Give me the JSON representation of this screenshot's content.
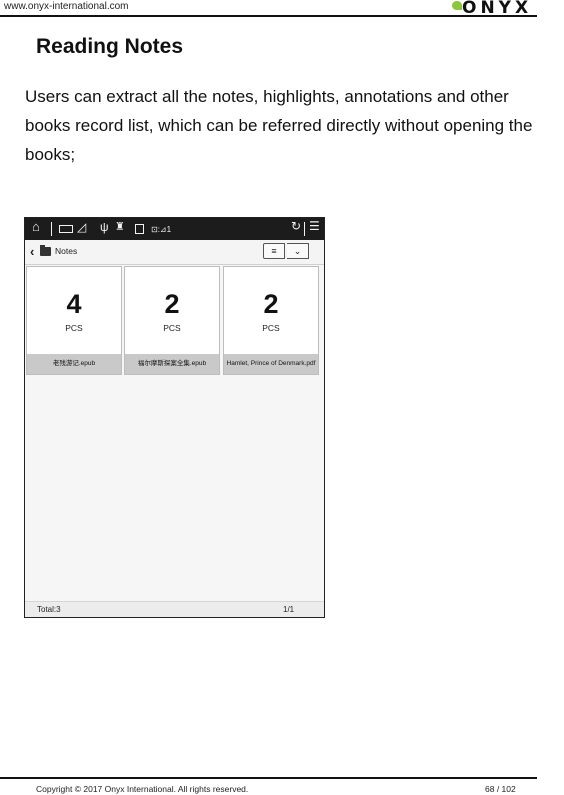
{
  "header": {
    "url": "www.onyx-international.com",
    "brand": "ONYX"
  },
  "section": {
    "title": "Reading Notes",
    "body": "Users can extract all the notes, highlights, annotations and other books record list, which can be referred directly without opening the books;"
  },
  "device": {
    "nav": {
      "back_glyph": "‹",
      "title": "Notes",
      "view_glyph": "≡",
      "dropdown_glyph": "⌄"
    },
    "cards": [
      {
        "count": "4",
        "unit": "PCS",
        "name": "老残游记.epub"
      },
      {
        "count": "2",
        "unit": "PCS",
        "name": "福尔摩斯探案全集.epub"
      },
      {
        "count": "2",
        "unit": "PCS",
        "name": "Hamlet, Prince of Denmark.pdf"
      }
    ],
    "footer": {
      "total": "Total:3",
      "page": "1/1"
    }
  },
  "footer": {
    "copyright": "Copyright © 2017 Onyx International. All rights reserved.",
    "page": "68 / 102"
  },
  "colors": {
    "brand_leaf": "#8cc63f",
    "status_bar": "#1c1c1c",
    "caption_bg": "#c9c9c9"
  },
  "icons": [
    "home-icon",
    "battery-icon",
    "signal-icon",
    "usb-icon",
    "android-icon",
    "sim-icon",
    "time-icon",
    "refresh-icon",
    "menu-icon",
    "folder-icon"
  ]
}
